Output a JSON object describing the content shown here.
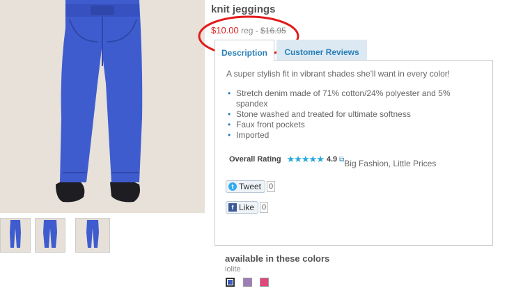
{
  "product": {
    "title": "knit jeggings",
    "price": "$10.00",
    "reg_label": "reg -",
    "original_price": "$16.95"
  },
  "tabs": [
    {
      "label": "Description",
      "active": true
    },
    {
      "label": "Customer Reviews",
      "active": false
    }
  ],
  "description": {
    "intro": "A super stylish fit in vibrant shades she'll want in every color!",
    "features": [
      "Stretch denim made of 71% cotton/24% polyester and 5% spandex",
      "Stone washed and treated for ultimate softness",
      "Faux front pockets",
      "Imported"
    ]
  },
  "rating": {
    "label": "Overall Rating",
    "stars": "★★★★★",
    "value": "4.9",
    "tagline": "Big Fashion, Little Prices"
  },
  "social": {
    "tweet_label": "Tweet",
    "tweet_count": "0",
    "like_label": "Like",
    "like_count": "0"
  },
  "colors": {
    "heading": "available in these colors",
    "selected_name": "iolite",
    "swatches": [
      "#3a5cb8",
      "#a07cb8",
      "#e0487a"
    ]
  },
  "theme": {
    "price_color": "#e02020",
    "link_color": "#2a7fb8",
    "annotation_circle_color": "#e21b1b",
    "product_color": "#3f5ccf"
  }
}
